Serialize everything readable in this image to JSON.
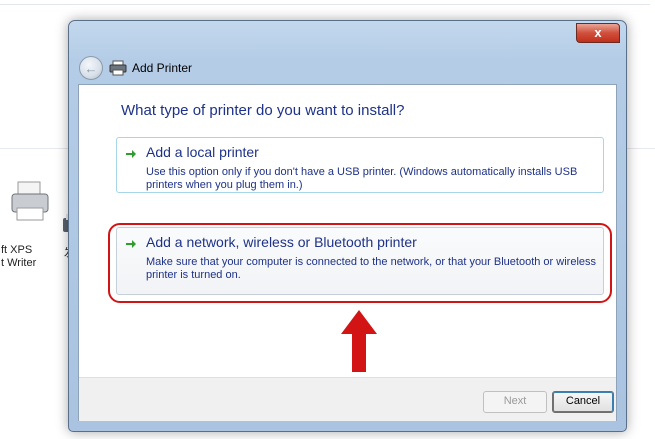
{
  "background": {
    "printer_label_1": "ft XPS\nt Writer",
    "printer_label_2": "发"
  },
  "dialog": {
    "title": "Add Printer",
    "close_label": "x",
    "heading": "What type of printer do you want to install?",
    "options": [
      {
        "title": "Add a local printer",
        "description": "Use this option only if you don't have a USB printer. (Windows automatically installs USB printers when you plug them in.)"
      },
      {
        "title": "Add a network, wireless or Bluetooth printer",
        "description": "Make sure that your computer is connected to the network, or that your Bluetooth or wireless printer is turned on."
      }
    ],
    "buttons": {
      "next": "Next",
      "cancel": "Cancel"
    }
  },
  "colors": {
    "link_blue": "#1e3287",
    "highlight_red": "#d21414",
    "option_arrow_green": "#2f9e2f"
  },
  "icons": {
    "back": "back-arrow-icon",
    "title": "printer-icon",
    "option": "green-arrow-icon",
    "annotation": "red-up-arrow"
  }
}
